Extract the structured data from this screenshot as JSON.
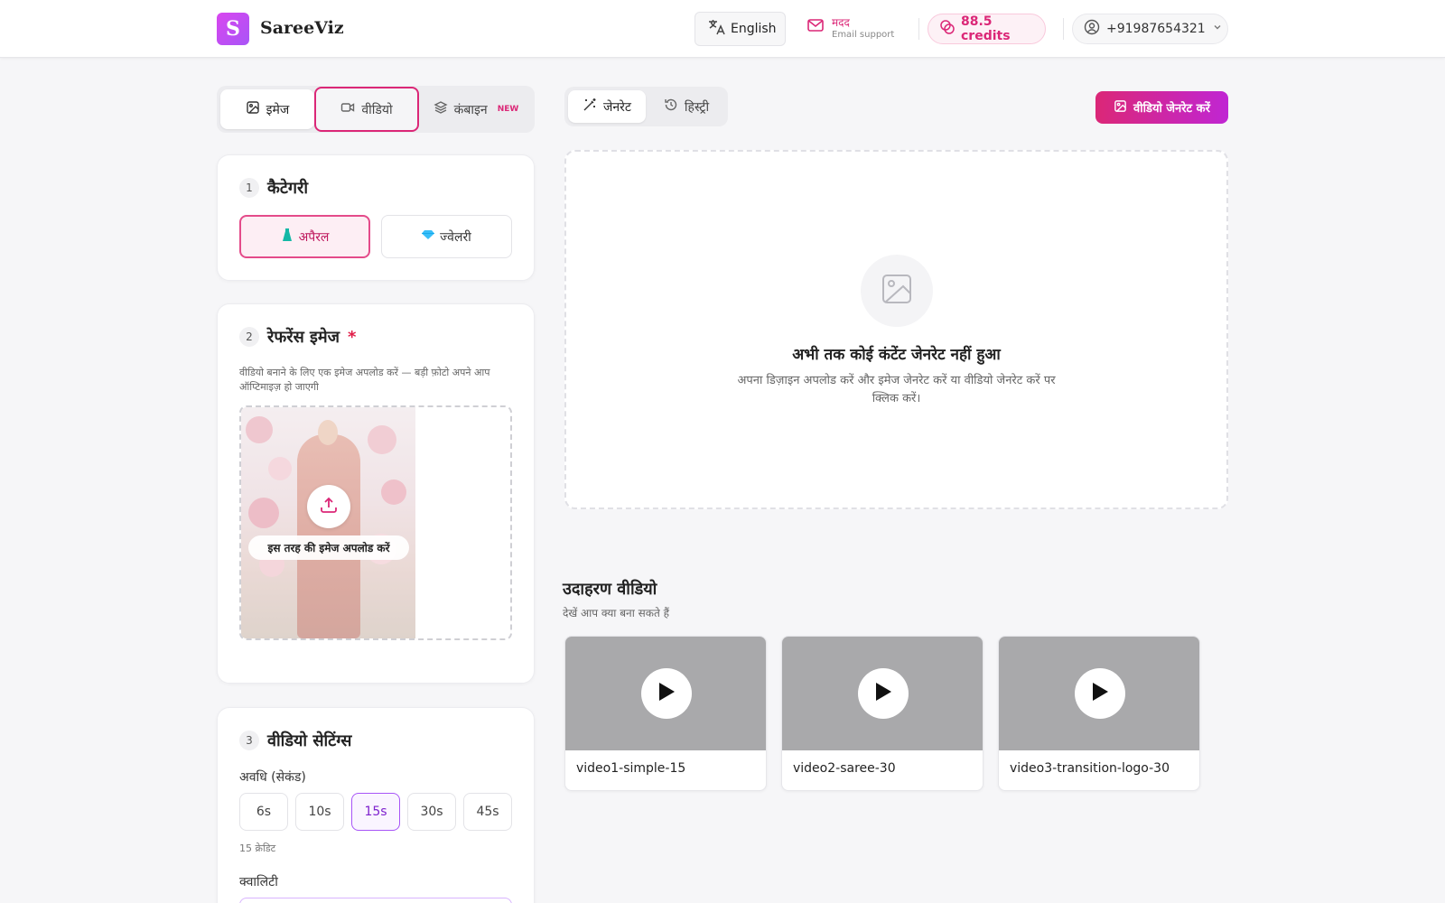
{
  "header": {
    "logo_letter": "S",
    "brand": "SareeViz",
    "language": "English",
    "help_title": "मदद",
    "help_sub": "Email support",
    "credits": "88.5 credits",
    "phone": "+91987654321"
  },
  "mode_tabs": [
    {
      "label": "इमेज",
      "icon": "image-icon"
    },
    {
      "label": "वीडियो",
      "icon": "video-icon"
    },
    {
      "label": "कंबाइन",
      "icon": "layers-icon",
      "badge": "NEW"
    }
  ],
  "category": {
    "step": "1",
    "title": "कैटेगरी",
    "options": [
      {
        "label": "अपैरल",
        "icon": "dress-icon",
        "selected": true
      },
      {
        "label": "ज्वेलरी",
        "icon": "gem-icon",
        "selected": false
      }
    ]
  },
  "reference": {
    "step": "2",
    "title": "रेफरेंस इमेज",
    "required_mark": "*",
    "description": "वीडियो बनाने के लिए एक इमेज अपलोड करें — बड़ी फ़ोटो अपने आप ऑप्टिमाइज़ हो जाएगी",
    "upload_label": "इस तरह की इमेज अपलोड करें"
  },
  "settings": {
    "step": "3",
    "title": "वीडियो सेटिंग्स",
    "duration_label": "अवधि (सेकंड)",
    "durations": [
      "6s",
      "10s",
      "15s",
      "30s",
      "45s"
    ],
    "selected_duration": "15s",
    "credits_hint": "15 क्रेडिट",
    "quality_label": "क्वालिटी"
  },
  "output_tabs": [
    {
      "label": "जेनरेट",
      "icon": "wand-icon"
    },
    {
      "label": "हिस्ट्री",
      "icon": "history-icon"
    }
  ],
  "generate_button": "वीडियो जेनरेट करें",
  "empty_state": {
    "title": "अभी तक कोई कंटेंट जेनरेट नहीं हुआ",
    "description": "अपना डिज़ाइन अपलोड करें और इमेज जेनरेट करें या वीडियो जेनरेट करें पर क्लिक करें।"
  },
  "examples": {
    "title": "उदाहरण वीडियो",
    "subtitle": "देखें आप क्या बना सकते हैं",
    "videos": [
      "video1-simple-15",
      "video2-saree-30",
      "video3-transition-logo-30"
    ]
  },
  "colors": {
    "accent": "#db2777",
    "accent_purple": "#c026d3",
    "thumb_gray": "#a9a9ab"
  }
}
